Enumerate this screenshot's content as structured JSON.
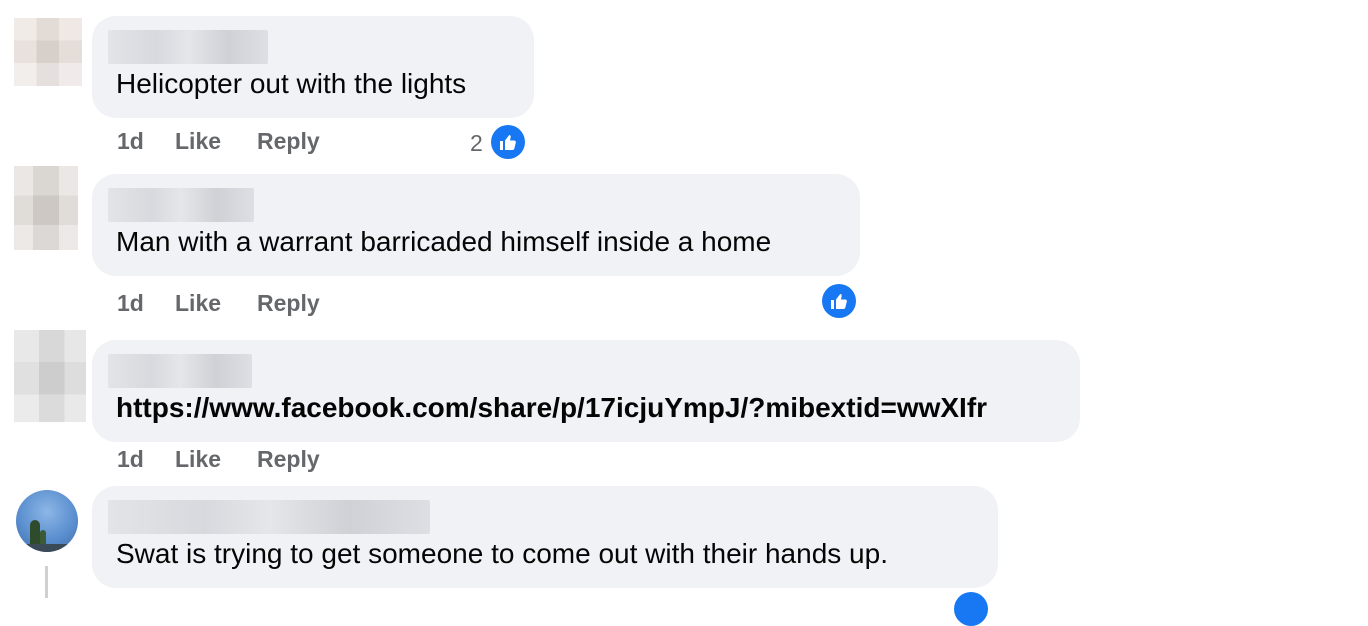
{
  "comments": [
    {
      "text": "Helicopter out with the lights",
      "time": "1d",
      "like_label": "Like",
      "reply_label": "Reply",
      "reaction_count": "2"
    },
    {
      "text": "Man with a warrant barricaded himself inside a home",
      "time": "1d",
      "like_label": "Like",
      "reply_label": "Reply"
    },
    {
      "text": "https://www.facebook.com/share/p/17icjuYmpJ/?mibextid=wwXIfr",
      "time": "1d",
      "like_label": "Like",
      "reply_label": "Reply"
    },
    {
      "text": "Swat is trying to get someone to come out with their hands up."
    }
  ],
  "icons": {
    "reaction": "like-thumbs-up-icon"
  },
  "colors": {
    "bubble_bg": "#f0f2f5",
    "action_text": "#65676b",
    "like_blue": "#1877f2",
    "text": "#050505"
  }
}
